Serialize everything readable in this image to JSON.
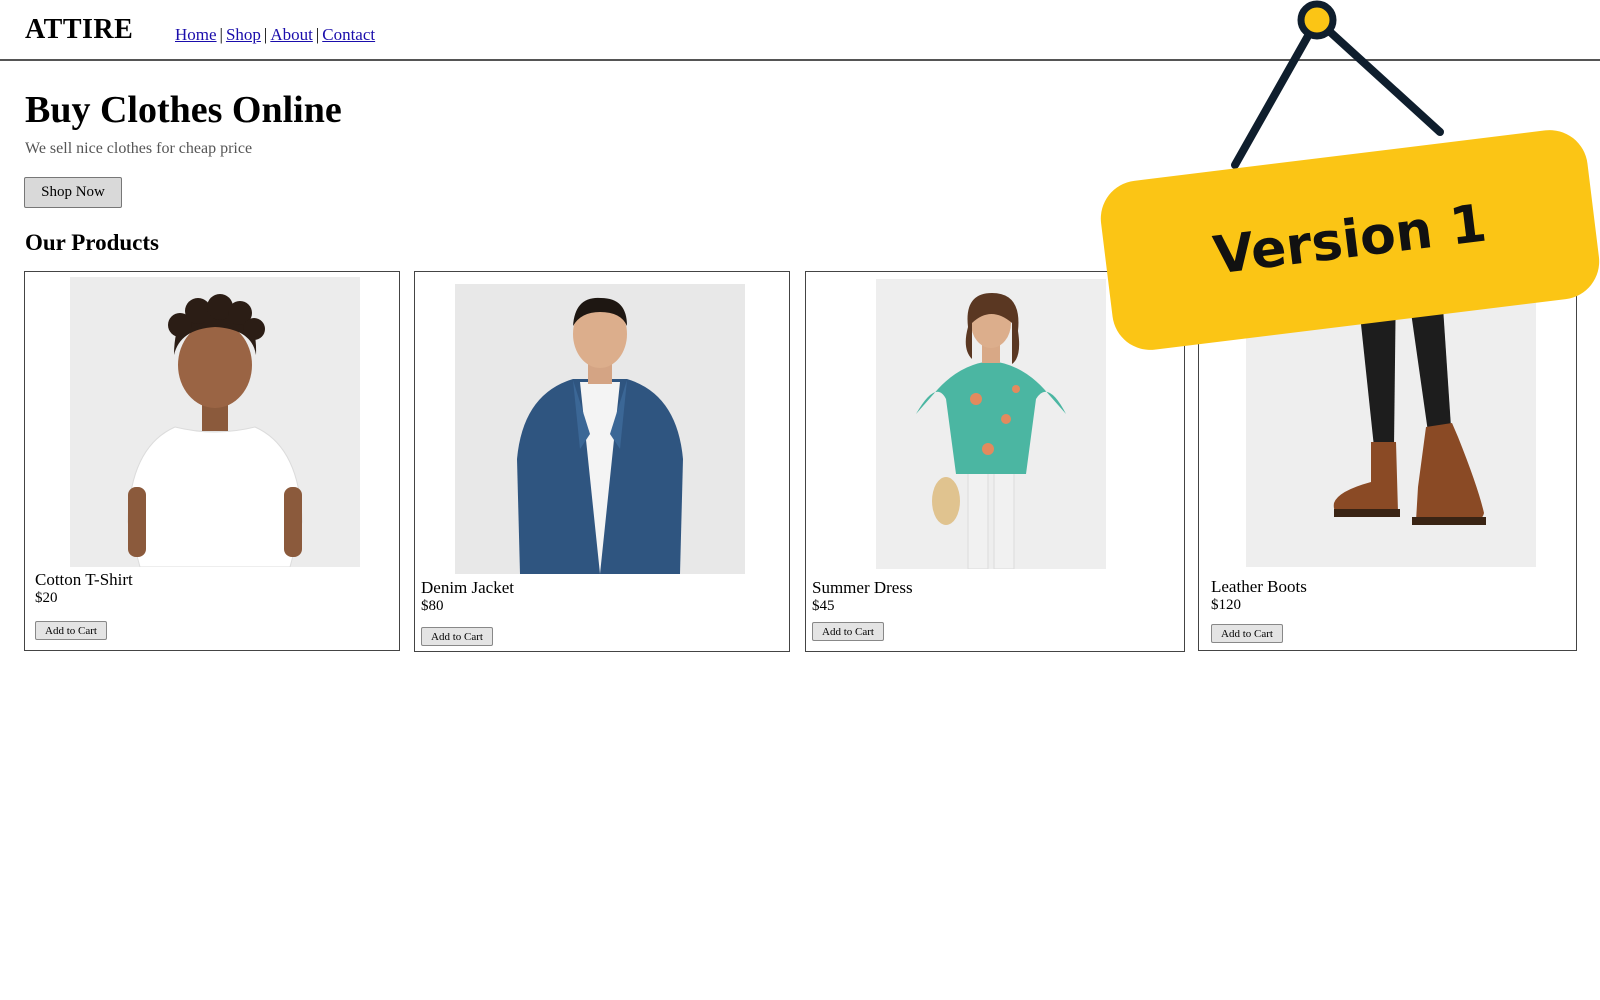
{
  "brand": "ATTIRE",
  "nav": {
    "links": [
      "Home",
      "Shop",
      "About",
      "Contact"
    ],
    "separator": "|"
  },
  "hero": {
    "title": "Buy Clothes Online",
    "subtitle": "We sell nice clothes for cheap price",
    "button_label": "Shop Now"
  },
  "products_section": {
    "title": "Our Products"
  },
  "products": [
    {
      "name": "Cotton T-Shirt",
      "price": "$20",
      "button_label": "Add to Cart",
      "image_icon": "boy-white-tshirt-photo"
    },
    {
      "name": "Denim Jacket",
      "price": "$80",
      "button_label": "Add to Cart",
      "image_icon": "man-denim-jacket-photo"
    },
    {
      "name": "Summer Dress",
      "price": "$45",
      "button_label": "Add to Cart",
      "image_icon": "woman-floral-top-photo"
    },
    {
      "name": "Leather Boots",
      "price": "$120",
      "button_label": "Add to Cart",
      "image_icon": "brown-leather-boots-photo"
    }
  ],
  "overlay_sign": {
    "text": "Version 1",
    "color": "#fbc515",
    "pin_color": "#fbc515",
    "string_color": "#0f1e2d"
  },
  "colors": {
    "link": "#1a0dab",
    "button_bg": "#d9d9d9"
  }
}
